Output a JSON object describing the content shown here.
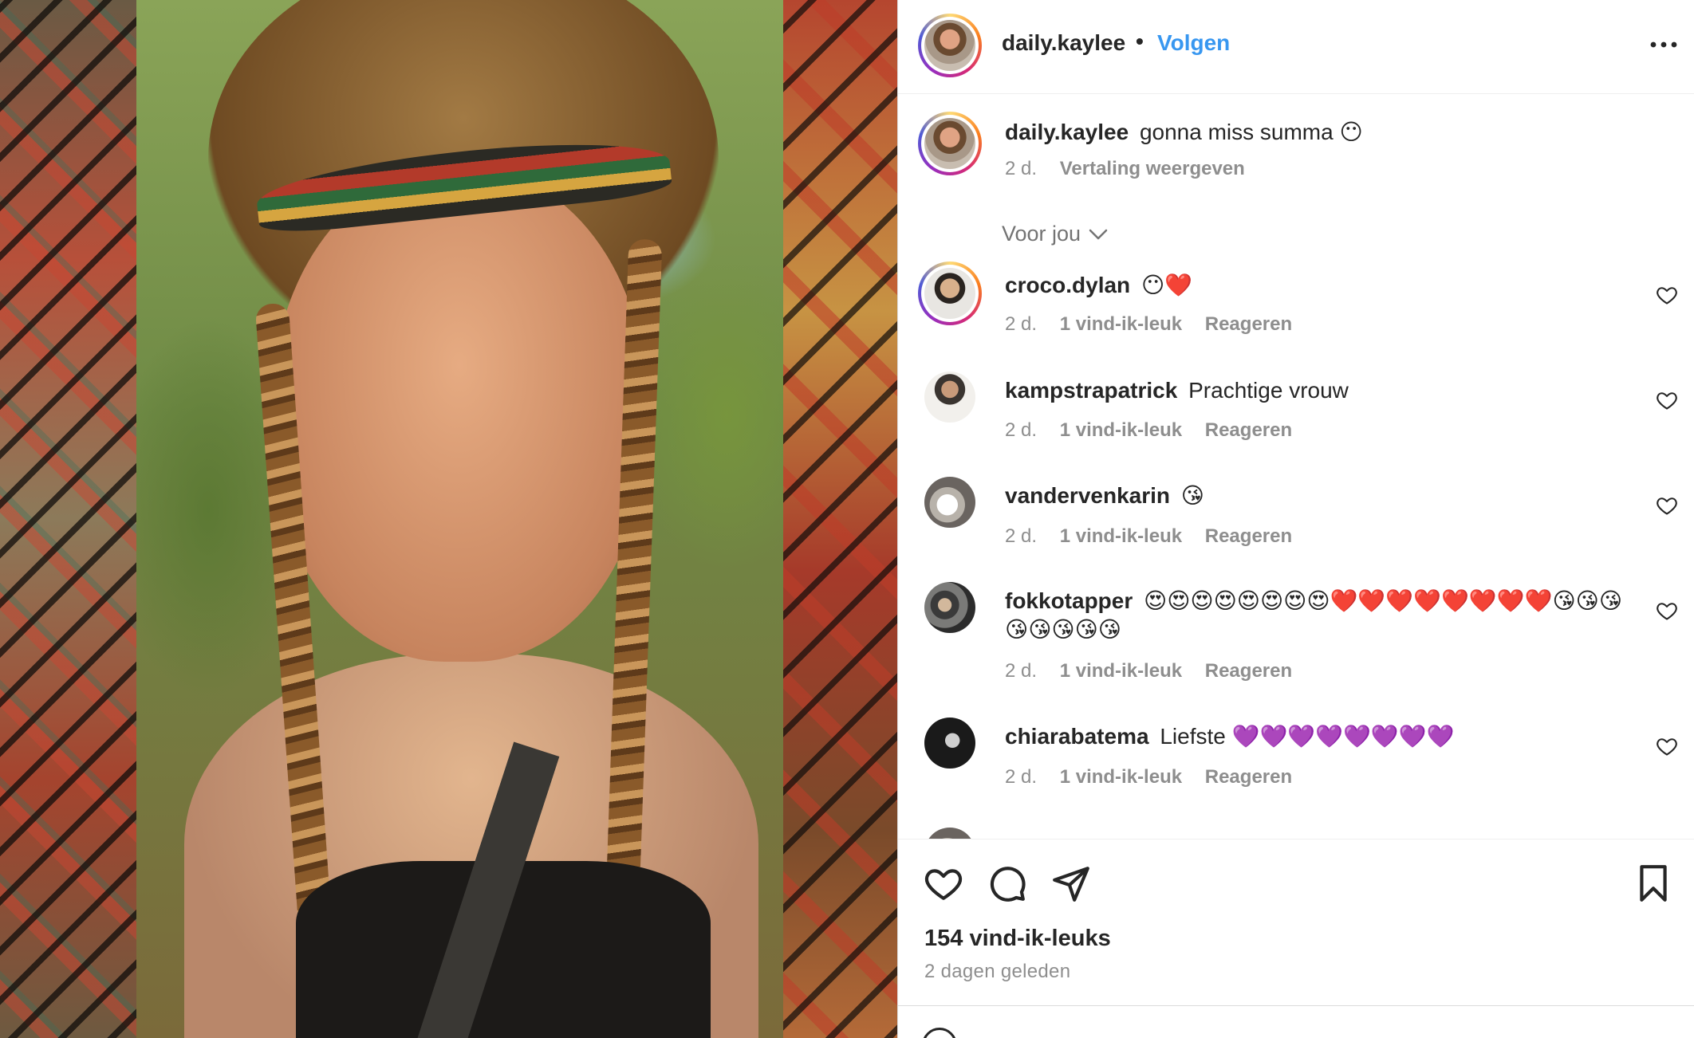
{
  "post": {
    "username": "daily.kaylee",
    "separator": "•",
    "follow_label": "Volgen",
    "more_label": "•••"
  },
  "caption": {
    "username": "daily.kaylee",
    "text": "gonna miss summa 😶",
    "time": "2 d.",
    "translate_label": "Vertaling weergeven"
  },
  "for_you_label": "Voor jou",
  "comments": [
    {
      "username": "croco.dylan",
      "text": "😶❤️",
      "time": "2 d.",
      "likes": "1 vind-ik-leuk",
      "reply": "Reageren"
    },
    {
      "username": "kampstrapatrick",
      "text": "Prachtige vrouw",
      "time": "2 d.",
      "likes": "1 vind-ik-leuk",
      "reply": "Reageren"
    },
    {
      "username": "vandervenkarin",
      "text": "😘",
      "time": "2 d.",
      "likes": "1 vind-ik-leuk",
      "reply": "Reageren"
    },
    {
      "username": "fokkotapper",
      "text": "😍😍😍😍😍😍😍😍❤️❤️❤️❤️❤️❤️❤️❤️😘😘😘😘😘😘😘😘",
      "time": "2 d.",
      "likes": "1 vind-ik-leuk",
      "reply": "Reageren"
    },
    {
      "username": "chiarabatema",
      "text": "Liefste 💜💜💜💜💜💜💜💜",
      "time": "2 d.",
      "likes": "1 vind-ik-leuk",
      "reply": "Reageren"
    }
  ],
  "likes_count": "154 vind-ik-leuks",
  "posted_ago": "2 dagen geleden",
  "colors": {
    "link": "#3897f0",
    "muted": "#8e8e8e",
    "text": "#262626"
  },
  "icons": [
    "heart-icon",
    "comment-icon",
    "share-icon",
    "bookmark-icon",
    "more-icon"
  ]
}
